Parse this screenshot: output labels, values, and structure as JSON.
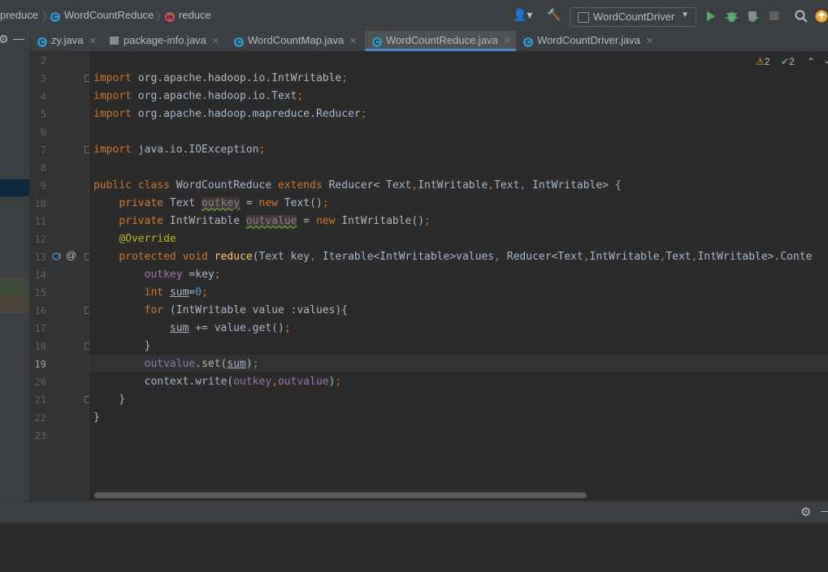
{
  "breadcrumb": {
    "items": [
      {
        "label": "preduce",
        "icon": ""
      },
      {
        "label": "WordCountReduce",
        "icon": "class-icon"
      },
      {
        "label": "reduce",
        "icon": "method-icon"
      }
    ]
  },
  "toolbar": {
    "run_config": "WordCountDriver"
  },
  "tabs": [
    {
      "label": "zy.java",
      "icon": "class-icon",
      "active": false
    },
    {
      "label": "package-info.java",
      "icon": "package-icon",
      "active": false
    },
    {
      "label": "WordCountMap.java",
      "icon": "class-icon",
      "active": false
    },
    {
      "label": "WordCountReduce.java",
      "icon": "class-icon",
      "active": true
    },
    {
      "label": "WordCountDriver.java",
      "icon": "class-icon",
      "active": false
    }
  ],
  "inspections": {
    "warnings": "2",
    "ok": "2"
  },
  "editor": {
    "current_line": 19,
    "line_numbers": [
      "2",
      "3",
      "4",
      "5",
      "6",
      "7",
      "8",
      "9",
      "10",
      "11",
      "12",
      "13",
      "14",
      "15",
      "16",
      "17",
      "18",
      "19",
      "20",
      "21",
      "22",
      "23"
    ],
    "lines": [
      "",
      "import org.apache.hadoop.io.IntWritable;",
      "import org.apache.hadoop.io.Text;",
      "import org.apache.hadoop.mapreduce.Reducer;",
      "",
      "import java.io.IOException;",
      "",
      "public class WordCountReduce extends Reducer< Text,IntWritable,Text, IntWritable> {",
      "    private Text outkey = new Text();",
      "    private IntWritable outvalue = new IntWritable();",
      "    @Override",
      "    protected void reduce(Text key, Iterable<IntWritable>values, Reducer<Text,IntWritable,Text,IntWritable>.Conte",
      "        outkey =key;",
      "        int sum=0;",
      "        for (IntWritable value :values){",
      "            sum += value.get();",
      "        }",
      "        outvalue.set(sum);",
      "        context.write(outkey,outvalue);",
      "    }",
      "}",
      ""
    ]
  }
}
